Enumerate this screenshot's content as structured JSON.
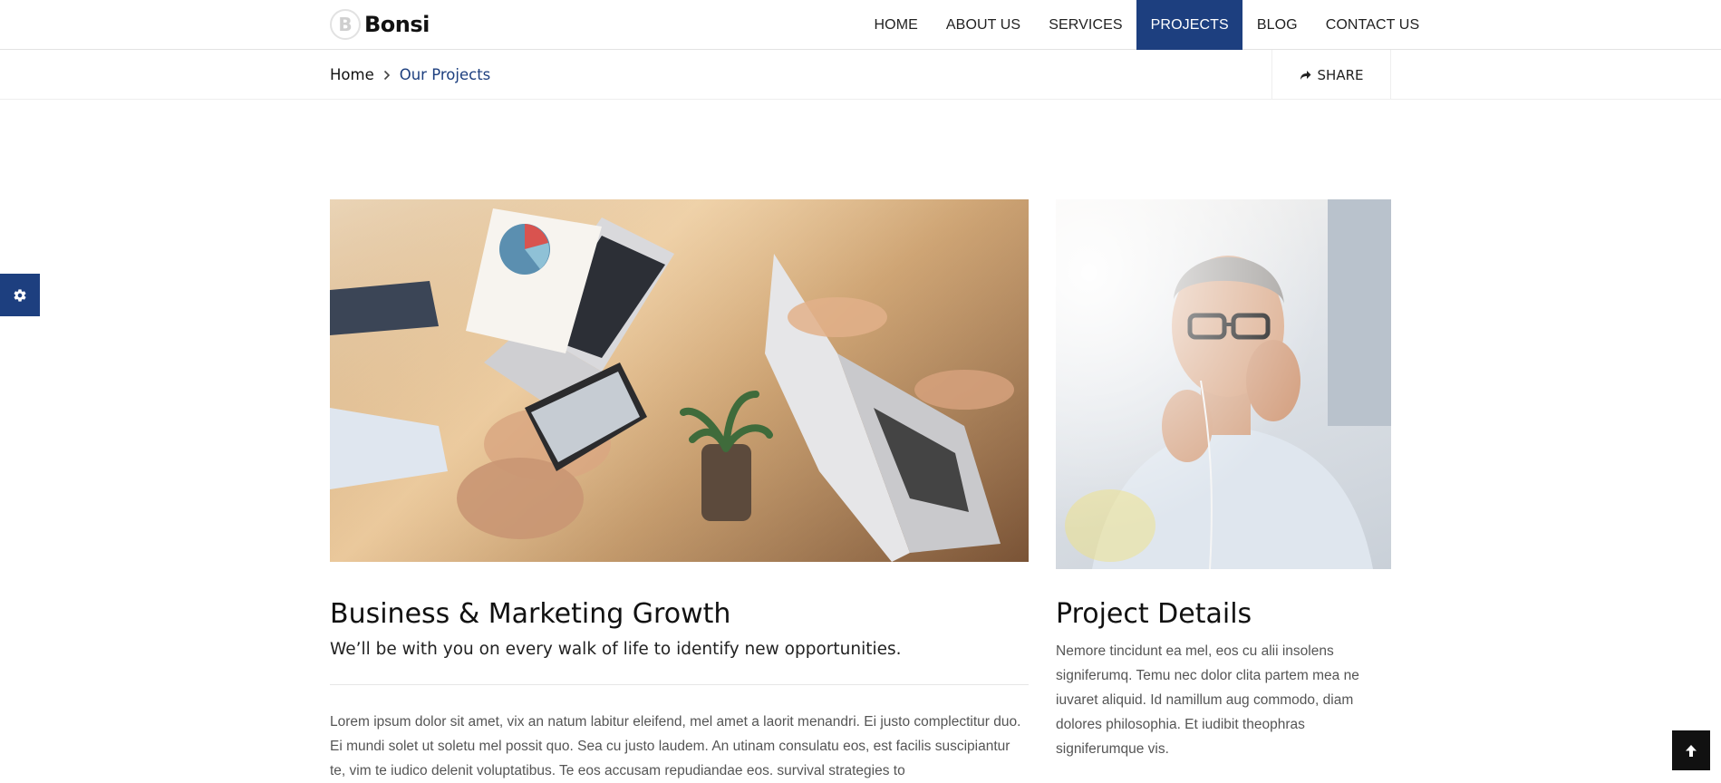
{
  "brand": {
    "logo_letter": "B",
    "name": "Bonsi"
  },
  "nav": {
    "items": [
      {
        "label": "HOME"
      },
      {
        "label": "ABOUT US"
      },
      {
        "label": "SERVICES"
      },
      {
        "label": "PROJECTS",
        "active": true
      },
      {
        "label": "BLOG"
      },
      {
        "label": "CONTACT US"
      }
    ]
  },
  "breadcrumb": {
    "home": "Home",
    "current": "Our Projects"
  },
  "share": {
    "label": "SHARE",
    "icon": "share-icon"
  },
  "settings": {
    "icon": "gear-icon"
  },
  "project": {
    "title": "Business & Marketing Growth",
    "subtitle": "We’ll be with you on every walk of life to identify new opportunities.",
    "body": "Lorem ipsum dolor sit amet, vix an natum labitur eleifend, mel amet a laorit menandri. Ei justo complectitur duo. Ei mundi solet ut soletu mel possit quo. Sea cu justo laudem. An utinam consulatu eos, est facilis suscipiantur te, vim te iudico delenit voluptatibus. Te eos accusam repudiandae eos. survival strategies to"
  },
  "details": {
    "title": "Project Details",
    "text": "Nemore tincidunt ea mel, eos cu alii insolens signiferumq. Temu nec dolor clita partem mea ne iuvaret aliquid. Id namillum aug commodo, diam dolores philosophia. Et iudibit theophras signiferumque vis."
  },
  "back_to_top": {
    "icon": "arrow-up-icon"
  },
  "colors": {
    "accent": "#1d3f7f",
    "dark": "#111111"
  }
}
